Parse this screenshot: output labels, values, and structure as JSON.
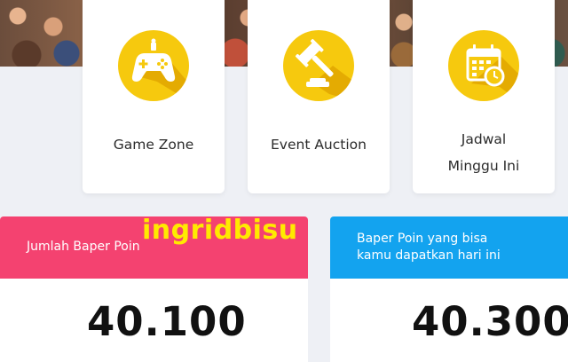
{
  "menu": [
    {
      "label": "Game Zone",
      "icon": "gamepad-icon"
    },
    {
      "label": "Event Auction",
      "icon": "gavel-icon"
    },
    {
      "label": "Jadwal\nMinggu Ini",
      "icon": "calendar-clock-icon"
    }
  ],
  "stats": [
    {
      "title": "Jumlah Baper Poin",
      "value": "40.100",
      "color": "#f44270"
    },
    {
      "title": "Baper Poin yang bisa\nkamu dapatkan hari ini",
      "value": "40.300",
      "color": "#13a3ef"
    }
  ],
  "watermark": "ingridbisu",
  "colors": {
    "icon_yellow": "#f6c90e",
    "background": "#eef0f5"
  }
}
